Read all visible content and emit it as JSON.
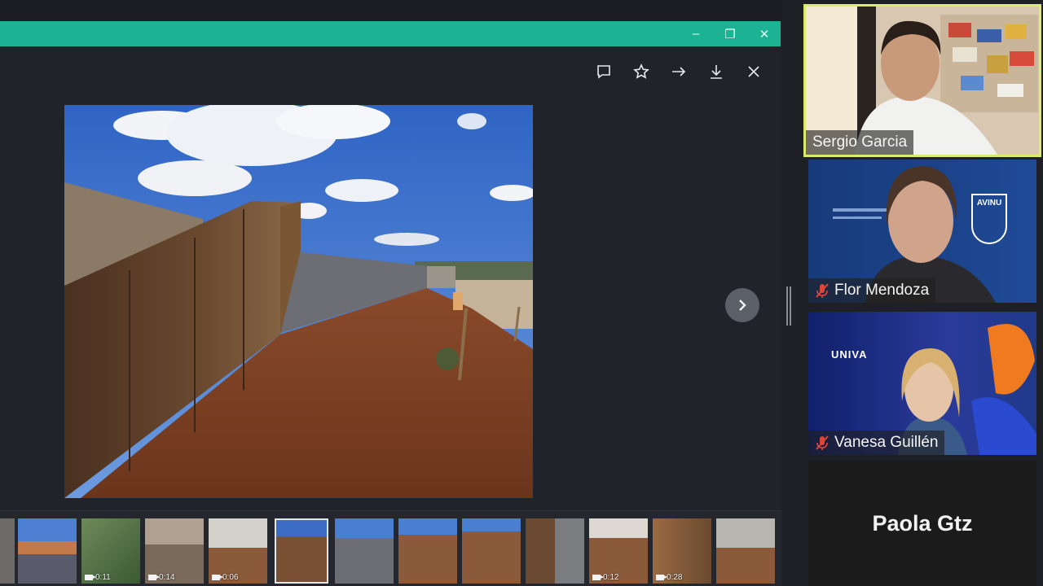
{
  "window": {
    "accent": "#1bb394",
    "controls": {
      "minimize": "–",
      "restore": "❐",
      "close": "✕"
    }
  },
  "toolbar": {
    "items": [
      {
        "name": "comment-icon"
      },
      {
        "name": "star-icon"
      },
      {
        "name": "arrow-right-icon"
      },
      {
        "name": "download-icon"
      },
      {
        "name": "close-icon"
      }
    ]
  },
  "navigation": {
    "next_icon": "chevron-right-icon"
  },
  "filmstrip": {
    "thumbs": [
      {
        "duration": ""
      },
      {
        "duration": ""
      },
      {
        "duration": "0:11"
      },
      {
        "duration": "0:14"
      },
      {
        "duration": "0:06"
      },
      {
        "duration": ""
      },
      {
        "duration": ""
      },
      {
        "duration": ""
      },
      {
        "duration": ""
      },
      {
        "duration": ""
      },
      {
        "duration": ""
      },
      {
        "duration": "0:12"
      },
      {
        "duration": "0:28"
      },
      {
        "duration": ""
      }
    ]
  },
  "participants": [
    {
      "name": "Sergio Garcia",
      "muted": false,
      "active_speaker": true
    },
    {
      "name": "Flor Mendoza",
      "muted": true
    },
    {
      "name": "Vanesa Guillén",
      "muted": true
    },
    {
      "name": "Paola Gtz",
      "muted": true,
      "video": false
    }
  ],
  "logos": {
    "flor_tile": "AVINU",
    "vanesa_tile": "UNIVA"
  },
  "colors": {
    "active_speaker_border": "#d9ec6b",
    "muted_icon": "#e0453a"
  }
}
